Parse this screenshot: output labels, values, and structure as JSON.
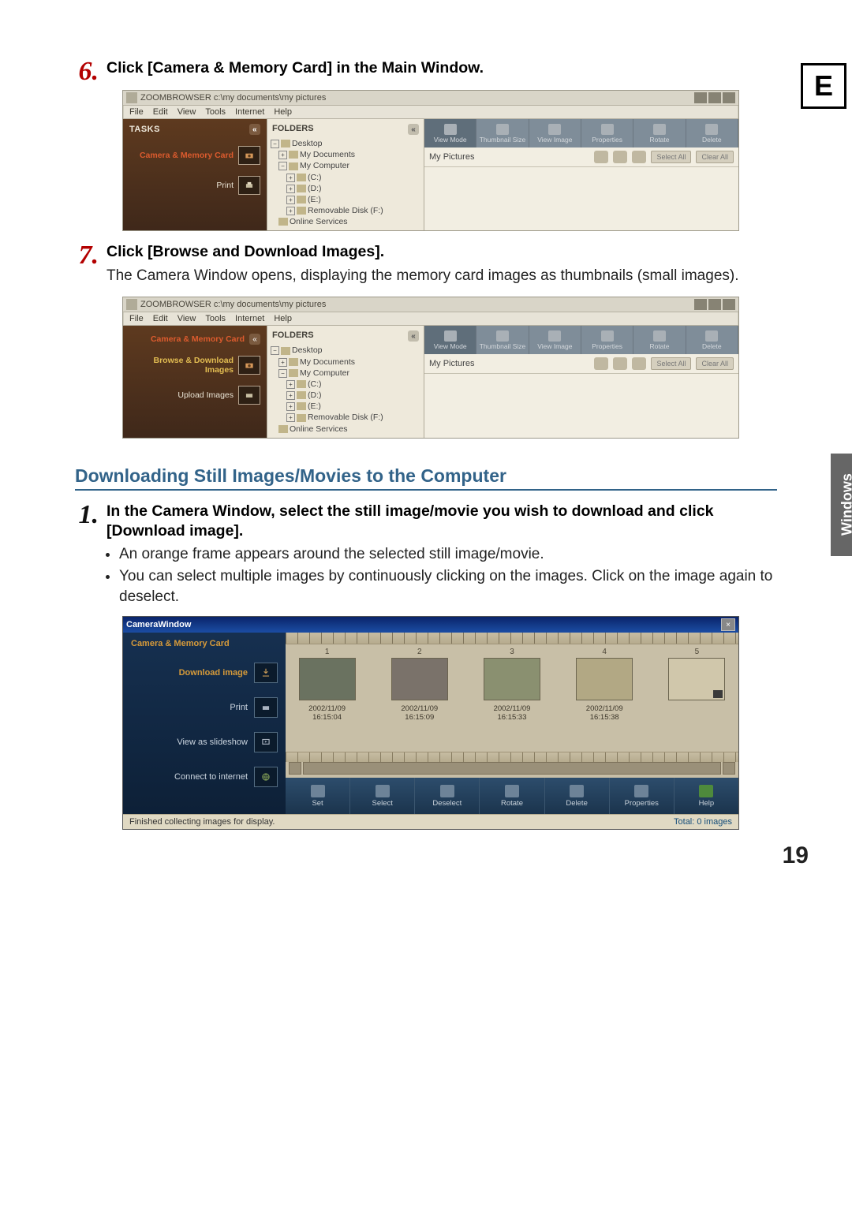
{
  "page": {
    "side_tab": "Windows",
    "e_tab": "E",
    "page_number": "19"
  },
  "step6": {
    "number": "6.",
    "heading": "Click [Camera & Memory Card] in the Main Window."
  },
  "step7": {
    "number": "7.",
    "heading": "Click [Browse and Download Images].",
    "text": "The Camera Window opens, displaying the memory card images as thumbnails (small images)."
  },
  "section2_heading": "Downloading Still Images/Movies to the Computer",
  "step1b": {
    "number": "1.",
    "heading": "In the Camera Window, select the still image/movie you wish to download and click [Download image].",
    "bullet1": "An orange frame appears around the selected still image/movie.",
    "bullet2": "You can select multiple images by continuously clicking on the images. Click on the image again to deselect."
  },
  "zb": {
    "title": "ZOOMBROWSER c:\\my documents\\my pictures",
    "menu": {
      "file": "File",
      "edit": "Edit",
      "view": "View",
      "tools": "Tools",
      "internet": "Internet",
      "help": "Help"
    },
    "tasks_label": "TASKS",
    "task_camera": "Camera & Memory Card",
    "task_print": "Print",
    "task_browse": "Browse & Download Images",
    "task_upload": "Upload Images",
    "folders_label": "FOLDERS",
    "tree": {
      "desktop": "Desktop",
      "mydocs": "My Documents",
      "mycomp": "My Computer",
      "c": "(C:)",
      "d": "(D:)",
      "e": "(E:)",
      "rem": "Removable Disk (F:)",
      "online": "Online Services"
    },
    "toolbar": {
      "viewmode": "View Mode",
      "thumbsize": "Thumbnail Size",
      "viewimage": "View Image",
      "properties": "Properties",
      "rotate": "Rotate",
      "delete": "Delete"
    },
    "subbar": {
      "breadcrumb": "My Pictures",
      "select_all": "Select All",
      "clear_all": "Clear All"
    }
  },
  "cw": {
    "title": "CameraWindow",
    "section": "Camera & Memory Card",
    "left": {
      "download": "Download image",
      "print": "Print",
      "slideshow": "View as slideshow",
      "internet": "Connect to internet"
    },
    "thumbs": [
      {
        "idx": "1",
        "date": "2002/11/09",
        "time": "16:15:04"
      },
      {
        "idx": "2",
        "date": "2002/11/09",
        "time": "16:15:09"
      },
      {
        "idx": "3",
        "date": "2002/11/09",
        "time": "16:15:33"
      },
      {
        "idx": "4",
        "date": "2002/11/09",
        "time": "16:15:38"
      },
      {
        "idx": "5",
        "date": "",
        "time": ""
      }
    ],
    "bottombar": {
      "set": "Set",
      "select": "Select",
      "deselect": "Deselect",
      "rotate": "Rotate",
      "delete": "Delete",
      "properties": "Properties",
      "help": "Help"
    },
    "status_left": "Finished collecting images for display.",
    "status_right": "Total: 0 images"
  }
}
